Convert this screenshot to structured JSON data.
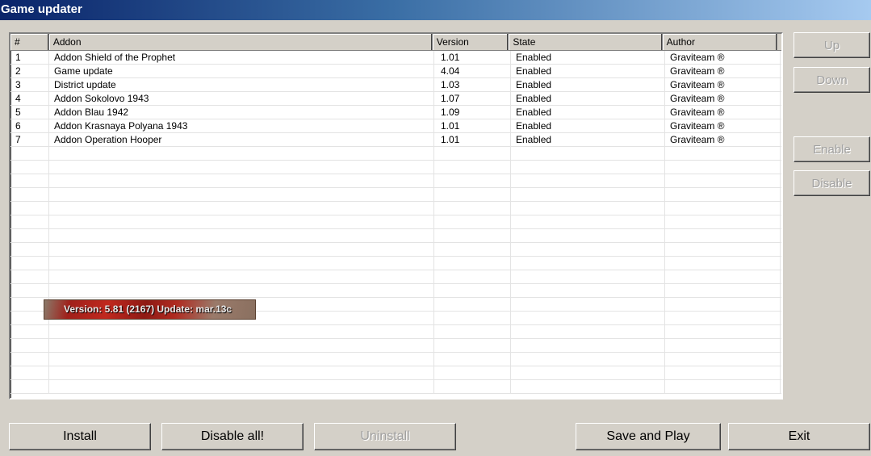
{
  "window": {
    "title": "Game updater"
  },
  "columns": [
    "#",
    "Addon",
    "Version",
    "State",
    "Author"
  ],
  "rows": [
    [
      "1",
      "Addon Shield of the Prophet",
      "1.01",
      "Enabled",
      "Graviteam ®"
    ],
    [
      "2",
      "Game update",
      "4.04",
      "Enabled",
      "Graviteam ®"
    ],
    [
      "3",
      "District update",
      "1.03",
      "Enabled",
      "Graviteam ®"
    ],
    [
      "4",
      "Addon Sokolovo 1943",
      "1.07",
      "Enabled",
      "Graviteam ®"
    ],
    [
      "5",
      "Addon Blau 1942",
      "1.09",
      "Enabled",
      "Graviteam ®"
    ],
    [
      "6",
      "Addon Krasnaya Polyana 1943",
      "1.01",
      "Enabled",
      "Graviteam ®"
    ],
    [
      "7",
      "Addon Operation Hooper",
      "1.01",
      "Enabled",
      "Graviteam ®"
    ]
  ],
  "empty_row_count": 18,
  "version_banner": "Version: 5.81 (2167)  Update: mar.13c",
  "side_buttons": {
    "up": "Up",
    "down": "Down",
    "enable": "Enable",
    "disable": "Disable"
  },
  "bottom_buttons": {
    "install": "Install",
    "disable_all": "Disable all!",
    "uninstall": "Uninstall",
    "save_and_play": "Save and Play",
    "exit": "Exit"
  },
  "colors": {
    "title_gradient_start": "#0a246a",
    "title_gradient_end": "#a6caf0",
    "face": "#d4d0c8"
  }
}
